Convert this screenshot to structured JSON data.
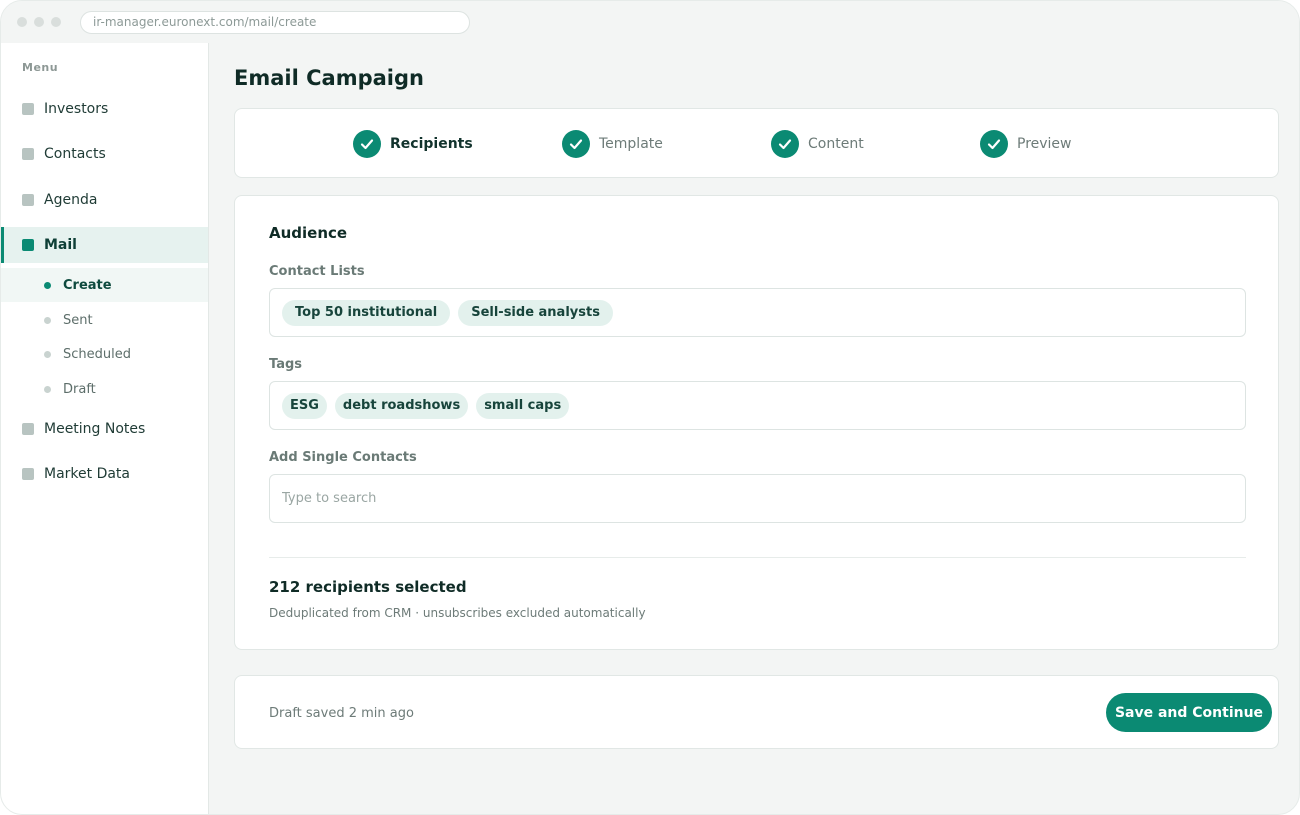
{
  "browser": {
    "url": "ir-manager.euronext.com/mail/create"
  },
  "sidebar": {
    "menu_title": "Menu",
    "items": [
      {
        "label": "Investors"
      },
      {
        "label": "Contacts"
      },
      {
        "label": "Agenda"
      },
      {
        "label": "Mail",
        "active": true
      },
      {
        "label": "Meeting Notes"
      },
      {
        "label": "Market Data"
      }
    ],
    "mail_subitems": [
      {
        "label": "Create",
        "active": true
      },
      {
        "label": "Sent"
      },
      {
        "label": "Scheduled"
      },
      {
        "label": "Draft"
      }
    ]
  },
  "page": {
    "title": "Email Campaign"
  },
  "stepper": {
    "steps": [
      {
        "label": "Recipients",
        "completed": true,
        "current": true,
        "icon": "check-icon"
      },
      {
        "label": "Template",
        "completed": true,
        "icon": "check-icon"
      },
      {
        "label": "Content",
        "completed": true,
        "icon": "check-icon"
      },
      {
        "label": "Preview",
        "completed": true,
        "icon": "check-icon"
      }
    ]
  },
  "audience": {
    "title": "Audience",
    "contact_lists": {
      "label": "Contact Lists",
      "chips": [
        "Top 50 institutional",
        "Sell-side analysts"
      ]
    },
    "tags": {
      "label": "Tags",
      "chips": [
        "ESG",
        "debt roadshows",
        "small caps"
      ]
    },
    "single_contacts": {
      "label": "Add Single Contacts",
      "placeholder": "Type to search",
      "value": ""
    },
    "summary": "212 recipients selected",
    "summary_note": "Deduplicated from CRM · unsubscribes excluded automatically"
  },
  "footer": {
    "status": "Draft saved 2 min ago",
    "primary_button": "Save and Continue"
  },
  "colors": {
    "accent": "#0b8a73",
    "chip_bg": "#e3f1ed",
    "background": "#f3f5f4"
  }
}
